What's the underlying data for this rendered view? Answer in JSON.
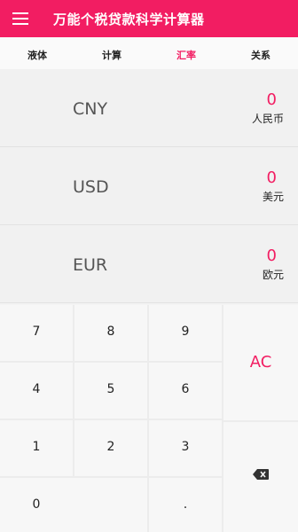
{
  "header": {
    "title": "万能个税贷款科学计算器"
  },
  "tabs": [
    "液体",
    "计算",
    "汇率",
    "关系"
  ],
  "active_tab": "汇率",
  "currencies": [
    {
      "code": "CNY",
      "amount": "0",
      "name": "人民币"
    },
    {
      "code": "USD",
      "amount": "0",
      "name": "美元"
    },
    {
      "code": "EUR",
      "amount": "0",
      "name": "欧元"
    }
  ],
  "keypad": {
    "k7": "7",
    "k8": "8",
    "k9": "9",
    "k4": "4",
    "k5": "5",
    "k6": "6",
    "k1": "1",
    "k2": "2",
    "k3": "3",
    "k0": "0",
    "kdot": ".",
    "clear": "AC",
    "backspace_icon": "backspace-icon"
  },
  "colors": {
    "accent": "#f21d62",
    "background": "#f3f3f3"
  }
}
